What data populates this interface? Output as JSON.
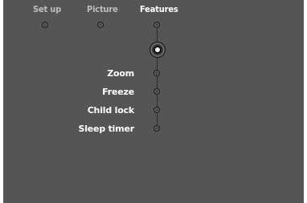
{
  "tabs": [
    {
      "label": "Set up",
      "active": false
    },
    {
      "label": "Picture",
      "active": false
    },
    {
      "label": "Features",
      "active": true
    }
  ],
  "menu": {
    "items": [
      "Zoom",
      "Freeze",
      "Child lock",
      "Sleep timer"
    ],
    "selected_index": null
  },
  "colors": {
    "background": "#555555",
    "active_text": "#ffffff",
    "inactive_text": "#bdbdbd"
  }
}
